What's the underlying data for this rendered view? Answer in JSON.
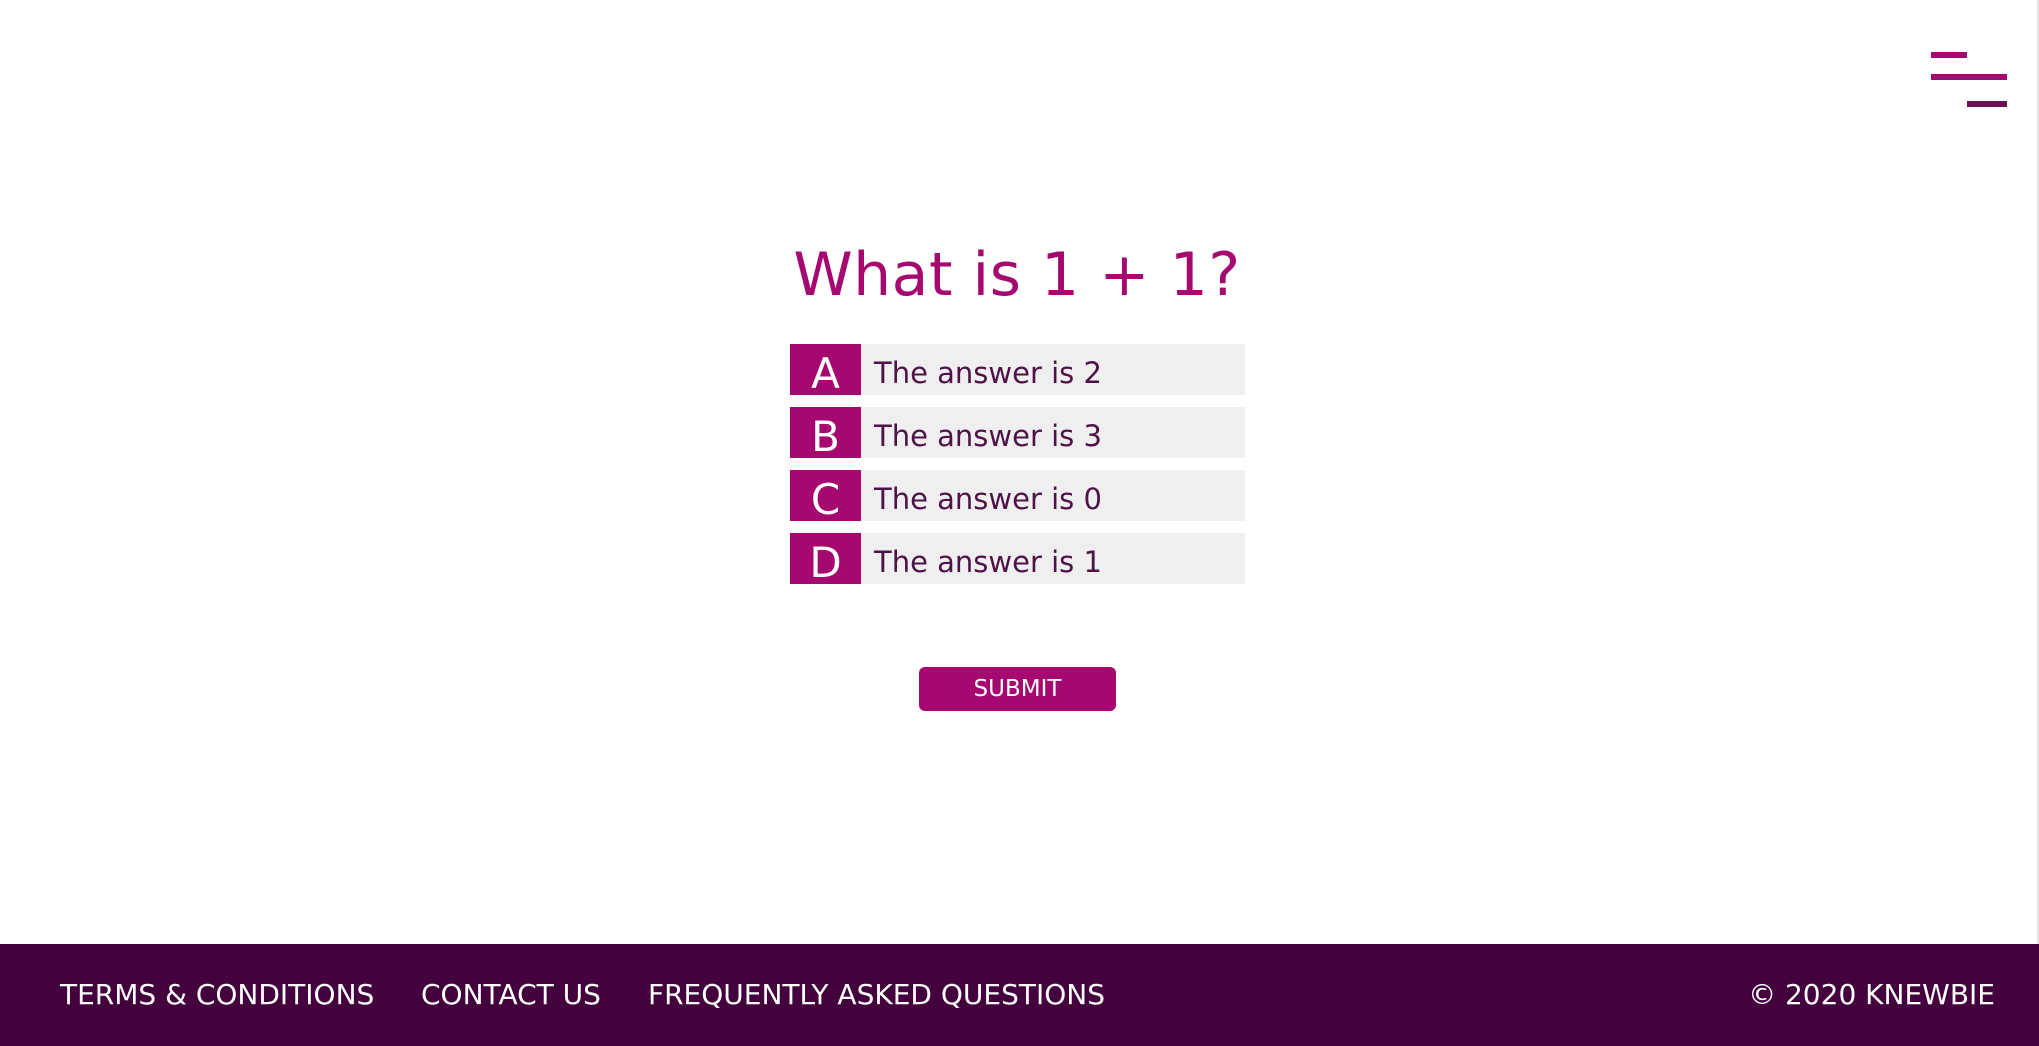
{
  "question": {
    "title": "What is 1 + 1?"
  },
  "options": [
    {
      "letter": "A",
      "text": "The answer is 2"
    },
    {
      "letter": "B",
      "text": "The answer is 3"
    },
    {
      "letter": "C",
      "text": "The answer is 0"
    },
    {
      "letter": "D",
      "text": "The answer is 1"
    }
  ],
  "submit_label": "SUBMIT",
  "footer": {
    "links": [
      "TERMS & CONDITIONS",
      "CONTACT US",
      "FREQUENTLY ASKED QUESTIONS"
    ],
    "copyright": "© 2020 KNEWBIE"
  },
  "icons": {
    "menu": "menu-icon"
  },
  "colors": {
    "accent": "#a5086e",
    "footer_bg": "#43023d",
    "option_bg": "#efefef",
    "option_text": "#4f1248"
  }
}
